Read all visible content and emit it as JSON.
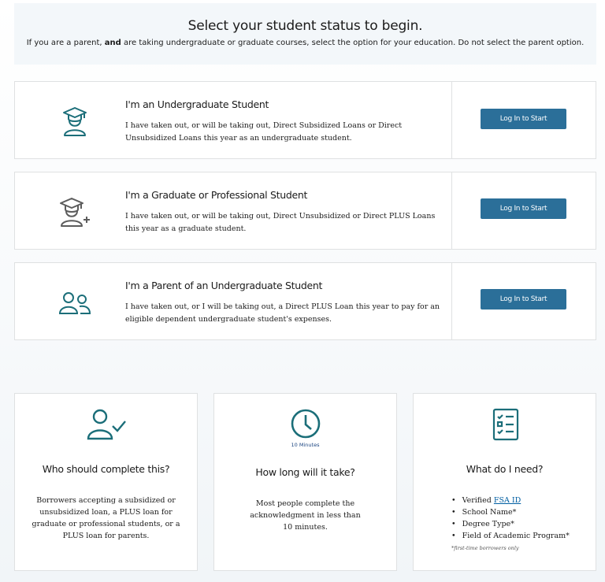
{
  "hero": {
    "heading": "Select your student status to begin.",
    "note_before": "If you are a parent,",
    "note_bold": "and",
    "note_after": "are taking undergraduate or graduate courses, select the option for your education. Do not select the parent option."
  },
  "cards": [
    {
      "title": "I'm an Undergraduate Student",
      "desc": "I have taken out, or will be taking out, Direct Subsidized Loans or Direct Unsubsidized Loans this year as an undergraduate student.",
      "button": "Log In to Start",
      "icon": "undergraduate-student-icon"
    },
    {
      "title": "I'm a Graduate or Professional Student",
      "desc": "I have taken out, or will be taking out, Direct Unsubsidized or Direct PLUS Loans this year as a graduate student.",
      "button": "Log In to Start",
      "icon": "graduate-student-icon"
    },
    {
      "title": "I'm a Parent of an Undergraduate Student",
      "desc": "I have taken out, or I will be taking out, a Direct PLUS Loan this year to pay for an eligible dependent undergraduate student's expenses.",
      "button": "Log In to Start",
      "icon": "parent-icon"
    }
  ],
  "info": {
    "who": {
      "title": "Who should complete this?",
      "body": "Borrowers accepting a subsidized or unsubsidized loan, a PLUS loan for graduate or professional students, or a PLUS loan for parents.",
      "icon": "user-check-icon"
    },
    "time": {
      "minutes": "10 Minutes",
      "title": "How long will it take?",
      "body": "Most people complete the acknowledgment in less than 10 minutes.",
      "icon": "clock-icon"
    },
    "need": {
      "title": "What do I need?",
      "item1_prefix": "Verified",
      "item1_link": "FSA ID",
      "item2": "School Name*",
      "item3": "Degree Type*",
      "item4": "Field of Academic Program*",
      "footnote": "*first-time borrowers only",
      "icon": "checklist-icon"
    }
  },
  "colors": {
    "accent": "#2b6f99",
    "icon_teal": "#1b6e79",
    "icon_gray": "#5c5c5c",
    "link": "#005ea2"
  }
}
